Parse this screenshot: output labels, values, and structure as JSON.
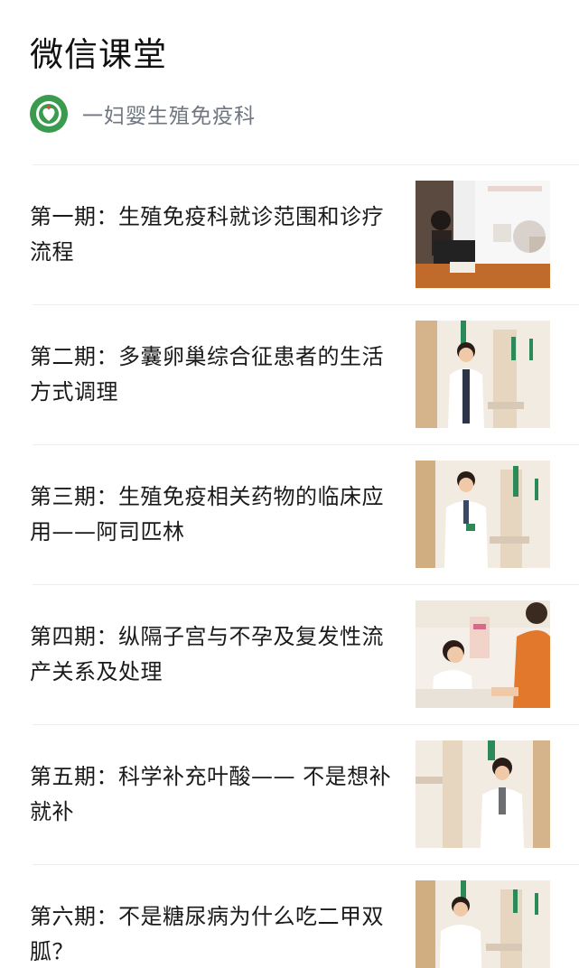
{
  "header": {
    "title": "微信课堂"
  },
  "account": {
    "name": "一妇婴生殖免疫科",
    "logo_icon": "hospital-logo-icon",
    "logo_color": "#3a9a4e"
  },
  "articles": [
    {
      "title": "第一期：生殖免疫科就诊范围和诊疗流程",
      "thumbnail": "lecture-podium-photo"
    },
    {
      "title": "第二期：多囊卵巢综合征患者的生活方式调理",
      "thumbnail": "doctor-portrait-photo"
    },
    {
      "title": "第三期：生殖免疫相关药物的临床应用——阿司匹林",
      "thumbnail": "doctor-portrait-photo"
    },
    {
      "title": "第四期：纵隔子宫与不孕及复发性流产关系及处理",
      "thumbnail": "consultation-photo"
    },
    {
      "title": "第五期：科学补充叶酸—— 不是想补就补",
      "thumbnail": "doctor-portrait-photo"
    },
    {
      "title": "第六期：不是糖尿病为什么吃二甲双胍？",
      "thumbnail": "doctor-portrait-photo"
    }
  ]
}
